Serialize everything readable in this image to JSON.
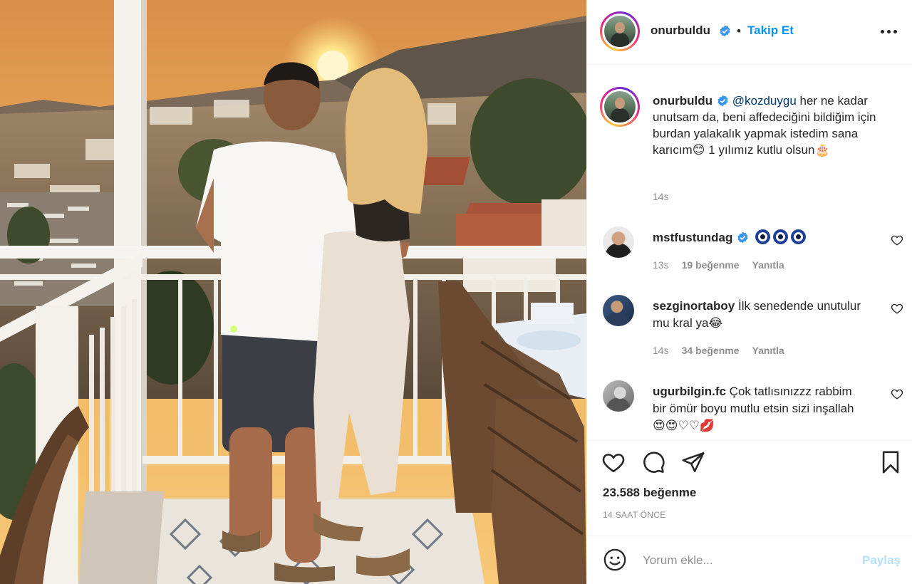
{
  "post": {
    "author": "onurbuldu",
    "follow_label": "Takip Et",
    "separator": "•",
    "caption": {
      "mention": "@kozduygu",
      "text": " her ne kadar unutsam da, beni affedeciğini bildiğim için burdan yalakalık yapmak istedim sana karıcım😊 1 yılımız kutlu olsun🎂",
      "time": "14s"
    },
    "comments": [
      {
        "user": "mstfustundag",
        "verified": true,
        "text": "",
        "emoji_count": 3,
        "time": "13s",
        "likes": "19 beğenme",
        "reply": "Yanıtla"
      },
      {
        "user": "sezginortaboy",
        "verified": false,
        "text": "İlk senedende unutulur mu kral ya😂",
        "time": "14s",
        "likes": "34 beğenme",
        "reply": "Yanıtla"
      },
      {
        "user": "ugurbilgin.fc",
        "verified": false,
        "text": "Çok tatlısınızzz rabbim bir ömür boyu mutlu etsin sizi inşallah😍😍♡♡💋"
      }
    ],
    "likes": "23.588 beğenme",
    "time_ago": "14 SAAT ÖNCE",
    "comment_placeholder": "Yorum ekle...",
    "post_button": "Paylaş"
  },
  "colors": {
    "accent": "#0095f6",
    "verified": "#3897f0",
    "post_disabled": "#b2dffc",
    "muted": "#8e8e8e"
  },
  "icons": [
    "more-icon",
    "verified-badge-icon",
    "heart-icon",
    "comment-icon",
    "share-icon",
    "bookmark-icon",
    "smile-icon"
  ]
}
